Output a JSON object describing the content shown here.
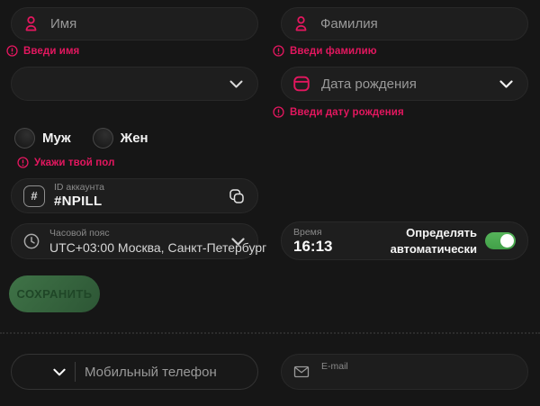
{
  "colors": {
    "background": "#161616",
    "field_fill": "#1e1e1e",
    "accent_pink": "#e3175f",
    "toggle_green": "#4caf50",
    "save_green_top": "#3f7347",
    "save_green_bottom": "#2d5635",
    "placeholder_gray": "#999999",
    "label_gray": "#8a8a8a"
  },
  "icons": {
    "person": "person-icon",
    "calendar": "calendar-icon",
    "alert": "alert-circle-icon",
    "chevron": "chevron-down-icon",
    "hash": "hash-icon",
    "copy": "copy-icon",
    "clock": "clock-icon",
    "envelope": "envelope-icon"
  },
  "fields": {
    "first_name": {
      "placeholder": "Имя",
      "error": "Введи имя"
    },
    "last_name": {
      "placeholder": "Фамилия",
      "error": "Введи фамилию"
    },
    "extra_dropdown": {
      "value": ""
    },
    "birth_date": {
      "placeholder": "Дата рождения",
      "error": "Введи дату рождения"
    },
    "gender": {
      "male": "Муж",
      "female": "Жен",
      "error": "Укажи твой пол"
    },
    "account_id": {
      "label": "ID аккаунта",
      "value": "#NPILL"
    },
    "timezone": {
      "label": "Часовой пояс",
      "value": "UTC+03:00 Москва, Санкт-Петербург"
    },
    "time": {
      "label": "Время",
      "value": "16:13"
    },
    "auto_detect": {
      "line1": "Определять",
      "line2": "автоматически",
      "state": "on"
    },
    "phone": {
      "placeholder": "Мобильный телефон"
    },
    "email": {
      "label": "E-mail",
      "value": ""
    }
  },
  "buttons": {
    "save": "СОХРАНИТЬ"
  }
}
